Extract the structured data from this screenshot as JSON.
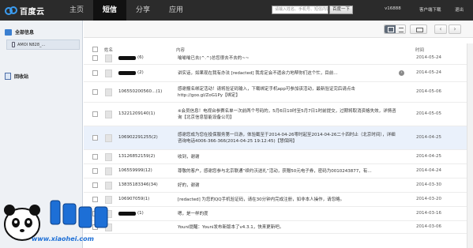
{
  "topbar": {
    "logo_text": "百度云",
    "nav": [
      {
        "label": "主页",
        "active": false
      },
      {
        "label": "短信",
        "active": true
      },
      {
        "label": "分享",
        "active": false
      },
      {
        "label": "应用",
        "active": false
      }
    ],
    "search_placeholder": "请输入姓名、手机号、短信内容搜索",
    "search_button": "百度一下",
    "user": "v16888",
    "client_download": "客户端下载",
    "logout": "退出"
  },
  "sidebar": {
    "all_messages": "全部信息",
    "device": "AMOI N828_...",
    "trash": "回收站"
  },
  "table": {
    "headers": {
      "name": "姓名",
      "content": "内容",
      "time": "时间"
    },
    "rows": [
      {
        "name": "(6)",
        "redacted_name": true,
        "content": "喻喻喻已去(^.^)总您很去不去的~~",
        "time": "2014-05-24"
      },
      {
        "name": "(2)",
        "redacted_name": true,
        "content": "讲实话，如果现在我有办法 [redacted] 我肯定会不遗余力地帮你们这个忙，目前…",
        "time": "2014-05-24",
        "has_action": true
      },
      {
        "name": "106550200560…(1)",
        "redacted_name": false,
        "content": "感谢报名绑定活动！请将验证码输入，下载绑定手机app可参加该活动，最新验证完后请点击 http://goo.gl/ZoG1Py【绑定】",
        "time": "2014-05-06"
      },
      {
        "name": "13221209140(1)",
        "redacted_name": false,
        "content": "※会员信息！电视台参赛名单一次前两个号码的，5月6日10时至5月7日1时前提交，过期将取消资格失效，详情咨询【北京信息智能设备公司】",
        "time": "2014-05-05"
      },
      {
        "name": "106902291255(2)",
        "redacted_name": false,
        "content": "感谢您成为您在投保服务第一日游，体验截至于2014-04-26零时起至2014-04-26二十四时止（北京时间），详细咨询电话4006-366-366(2014-04-25 19:12:45)【慧保网】",
        "time": "2014-04-25",
        "highlight": true
      },
      {
        "name": "13126852159(2)",
        "redacted_name": false,
        "content": "收到，谢谢",
        "time": "2014-04-25"
      },
      {
        "name": "106559999(12)",
        "redacted_name": false,
        "content": "尊敬的客户，感谢您参与北京联通“续约沃送礼”活动，获赠50元电子券，密码为0010243877，有…",
        "time": "2014-04-24"
      },
      {
        "name": "13835183346(34)",
        "redacted_name": false,
        "content": "好的，谢谢",
        "time": "2014-03-30"
      },
      {
        "name": "106907059(1)",
        "redacted_name": false,
        "content": "[redacted] 为您的QQ手机验证码，请在30分钟内完成注册，如非本人操作，请忽略。",
        "time": "2014-03-20"
      },
      {
        "name": "(1)",
        "redacted_name": true,
        "content": "嗯，是一样的度",
        "time": "2014-03-16"
      },
      {
        "name": "",
        "redacted_name": false,
        "content": "Youni提醒：Youni发布新版本了v4.3.1，快来更新吧。",
        "time": "2014-03-06"
      }
    ]
  },
  "watermark": {
    "text": "小黑游戏",
    "site": "www.xiaohei.com"
  },
  "colors": {
    "topbar": "#2b2b2b",
    "sidebar": "#eef1f5",
    "highlight_row": "#eaf1fb",
    "logo_blue": "#3b7fd0"
  }
}
